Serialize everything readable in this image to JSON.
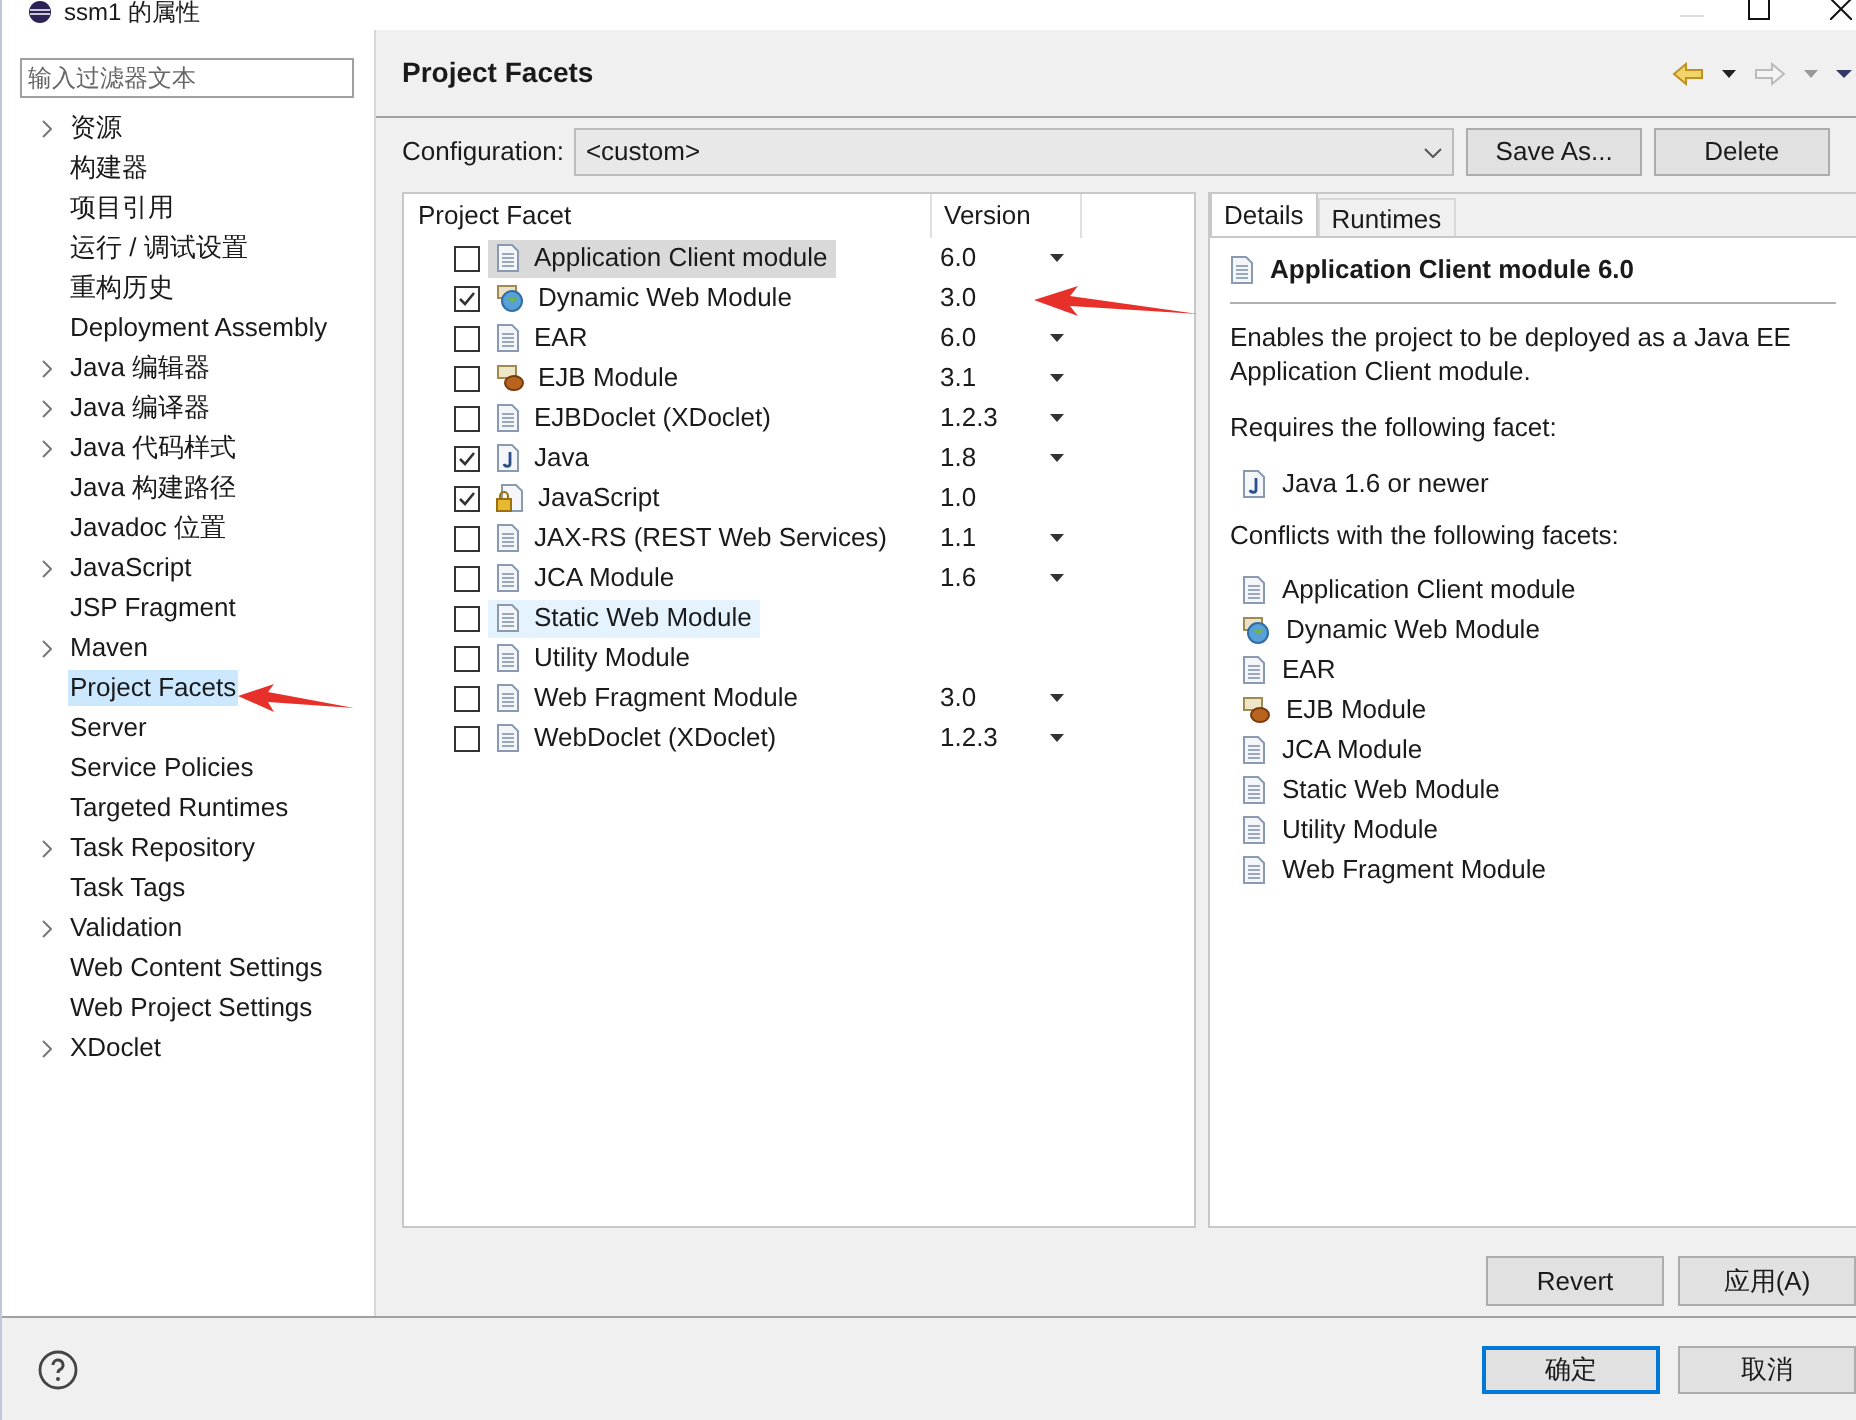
{
  "window": {
    "title": "ssm1 的属性"
  },
  "sidebar": {
    "filter_placeholder": "输入过滤器文本",
    "items": [
      {
        "label": "资源",
        "expandable": true,
        "selected": false
      },
      {
        "label": "构建器",
        "expandable": false,
        "selected": false
      },
      {
        "label": "项目引用",
        "expandable": false,
        "selected": false
      },
      {
        "label": "运行 / 调试设置",
        "expandable": false,
        "selected": false
      },
      {
        "label": "重构历史",
        "expandable": false,
        "selected": false
      },
      {
        "label": "Deployment Assembly",
        "expandable": false,
        "selected": false
      },
      {
        "label": "Java 编辑器",
        "expandable": true,
        "selected": false
      },
      {
        "label": "Java 编译器",
        "expandable": true,
        "selected": false
      },
      {
        "label": "Java 代码样式",
        "expandable": true,
        "selected": false
      },
      {
        "label": "Java 构建路径",
        "expandable": false,
        "selected": false
      },
      {
        "label": "Javadoc 位置",
        "expandable": false,
        "selected": false
      },
      {
        "label": "JavaScript",
        "expandable": true,
        "selected": false
      },
      {
        "label": "JSP Fragment",
        "expandable": false,
        "selected": false
      },
      {
        "label": "Maven",
        "expandable": true,
        "selected": false
      },
      {
        "label": "Project Facets",
        "expandable": false,
        "selected": true
      },
      {
        "label": "Server",
        "expandable": false,
        "selected": false
      },
      {
        "label": "Service Policies",
        "expandable": false,
        "selected": false
      },
      {
        "label": "Targeted Runtimes",
        "expandable": false,
        "selected": false
      },
      {
        "label": "Task Repository",
        "expandable": true,
        "selected": false
      },
      {
        "label": "Task Tags",
        "expandable": false,
        "selected": false
      },
      {
        "label": "Validation",
        "expandable": true,
        "selected": false
      },
      {
        "label": "Web Content Settings",
        "expandable": false,
        "selected": false
      },
      {
        "label": "Web Project Settings",
        "expandable": false,
        "selected": false
      },
      {
        "label": "XDoclet",
        "expandable": true,
        "selected": false
      }
    ]
  },
  "page": {
    "title": "Project Facets",
    "configuration_label": "Configuration:",
    "configuration_value": "<custom>",
    "save_as": "Save As...",
    "delete": "Delete"
  },
  "facets": {
    "columns": [
      "Project Facet",
      "Version"
    ],
    "rows": [
      {
        "kind": "doc",
        "name": "Application Client module",
        "version": "6.0",
        "checked": false,
        "selected": true,
        "hovered": false,
        "dropdown": true
      },
      {
        "kind": "web",
        "name": "Dynamic Web Module",
        "version": "3.0",
        "checked": true,
        "selected": false,
        "hovered": false,
        "dropdown": false
      },
      {
        "kind": "doc",
        "name": "EAR",
        "version": "6.0",
        "checked": false,
        "selected": false,
        "hovered": false,
        "dropdown": true
      },
      {
        "kind": "ejb",
        "name": "EJB Module",
        "version": "3.1",
        "checked": false,
        "selected": false,
        "hovered": false,
        "dropdown": true
      },
      {
        "kind": "doc",
        "name": "EJBDoclet (XDoclet)",
        "version": "1.2.3",
        "checked": false,
        "selected": false,
        "hovered": false,
        "dropdown": true
      },
      {
        "kind": "java",
        "name": "Java",
        "version": "1.8",
        "checked": true,
        "selected": false,
        "hovered": false,
        "dropdown": true
      },
      {
        "kind": "js",
        "name": "JavaScript",
        "version": "1.0",
        "checked": true,
        "selected": false,
        "hovered": false,
        "dropdown": false
      },
      {
        "kind": "doc",
        "name": "JAX-RS (REST Web Services)",
        "version": "1.1",
        "checked": false,
        "selected": false,
        "hovered": false,
        "dropdown": true
      },
      {
        "kind": "doc",
        "name": "JCA Module",
        "version": "1.6",
        "checked": false,
        "selected": false,
        "hovered": false,
        "dropdown": true
      },
      {
        "kind": "doc",
        "name": "Static Web Module",
        "checked": false,
        "selected": false,
        "hovered": true,
        "dropdown": false
      },
      {
        "kind": "doc",
        "name": "Utility Module",
        "checked": false,
        "selected": false,
        "hovered": false,
        "dropdown": false
      },
      {
        "kind": "doc",
        "name": "Web Fragment Module",
        "version": "3.0",
        "checked": false,
        "selected": false,
        "hovered": false,
        "dropdown": true
      },
      {
        "kind": "doc",
        "name": "WebDoclet (XDoclet)",
        "version": "1.2.3",
        "checked": false,
        "selected": false,
        "hovered": false,
        "dropdown": true
      }
    ]
  },
  "details": {
    "tabs": [
      {
        "label": "Details",
        "selected": true
      },
      {
        "label": "Runtimes",
        "selected": false
      }
    ],
    "heading": "Application Client module 6.0",
    "description": "Enables the project to be deployed as a Java EE Application Client module.",
    "requires_label": "Requires the following facet:",
    "requires": [
      {
        "kind": "java",
        "name": "Java 1.6 or newer"
      }
    ],
    "conflicts_label": "Conflicts with the following facets:",
    "conflicts": [
      {
        "kind": "doc",
        "name": "Application Client module"
      },
      {
        "kind": "web",
        "name": "Dynamic Web Module"
      },
      {
        "kind": "doc",
        "name": "EAR"
      },
      {
        "kind": "ejb",
        "name": "EJB Module"
      },
      {
        "kind": "doc",
        "name": "JCA Module"
      },
      {
        "kind": "doc",
        "name": "Static Web Module"
      },
      {
        "kind": "doc",
        "name": "Utility Module"
      },
      {
        "kind": "doc",
        "name": "Web Fragment Module"
      }
    ]
  },
  "page_buttons": [
    "Revert",
    "应用(A)"
  ],
  "dialog_buttons": [
    {
      "label": "确定",
      "default": true
    },
    {
      "label": "取消",
      "default": false
    }
  ]
}
